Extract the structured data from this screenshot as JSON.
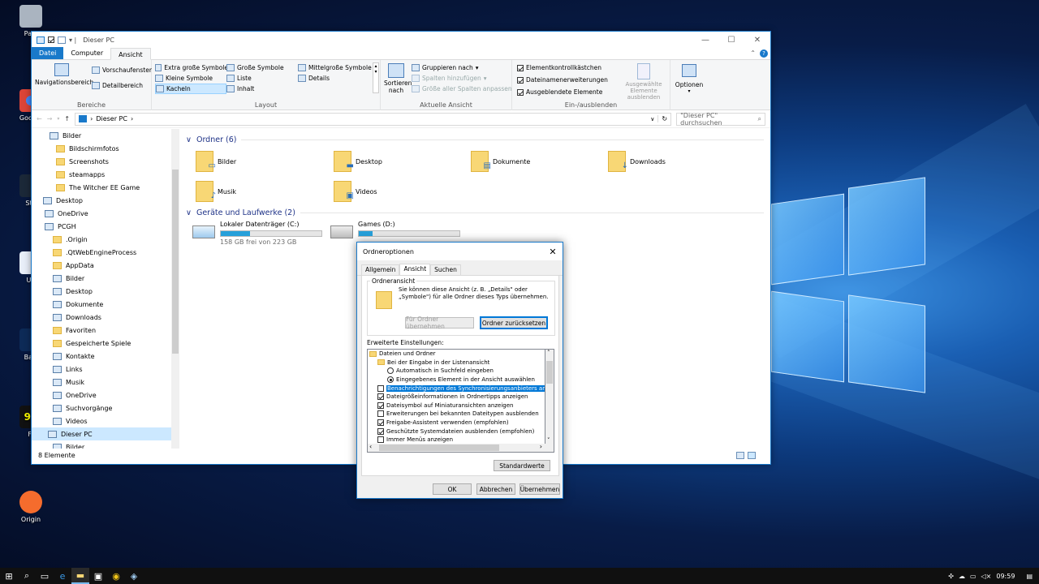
{
  "explorer": {
    "title": "Dieser PC",
    "tabs": [
      "Datei",
      "Computer",
      "Ansicht"
    ],
    "ribbon": {
      "panes": {
        "nav": "Navigationsbereich",
        "preview": "Vorschaufenster",
        "details": "Detailbereich",
        "label": "Bereiche"
      },
      "layout": {
        "items": [
          "Extra große Symbole",
          "Große Symbole",
          "Mittelgroße Symbole",
          "Kleine Symbole",
          "Liste",
          "Details",
          "Kacheln",
          "Inhalt"
        ],
        "label": "Layout"
      },
      "current": {
        "sort": "Sortieren",
        "sort2": "nach",
        "group": "Gruppieren nach",
        "add_cols": "Spalten hinzufügen",
        "fit_cols": "Größe aller Spalten anpassen",
        "label": "Aktuelle Ansicht"
      },
      "showhide": {
        "cb1": "Elementkontrollkästchen",
        "cb2": "Dateinamenerweiterungen",
        "cb3": "Ausgeblendete Elemente",
        "hide1": "Ausgewählte",
        "hide2": "Elemente ausblenden",
        "label": "Ein-/ausblenden"
      },
      "options": "Optionen"
    },
    "address": "Dieser PC",
    "search_placeholder": "\"Dieser PC\" durchsuchen",
    "nav": [
      "Bilder",
      "Bildschirmfotos",
      "Screenshots",
      "steamapps",
      "The Witcher EE Game",
      "Desktop",
      "OneDrive",
      "PCGH",
      ".Origin",
      ".QtWebEngineProcess",
      "AppData",
      "Bilder",
      "Desktop",
      "Dokumente",
      "Downloads",
      "Favoriten",
      "Gespeicherte Spiele",
      "Kontakte",
      "Links",
      "Musik",
      "OneDrive",
      "Suchvorgänge",
      "Videos",
      "Dieser PC",
      "Bilder"
    ],
    "folders_header": "Ordner (6)",
    "folders": [
      "Bilder",
      "Desktop",
      "Dokumente",
      "Downloads",
      "Musik",
      "Videos"
    ],
    "drives_header": "Geräte und Laufwerke (2)",
    "drives": [
      {
        "name": "Lokaler Datenträger (C:)",
        "free": "158 GB frei von 223 GB",
        "used": 0.29
      },
      {
        "name": "Games (D:)",
        "free": "",
        "used": 0.14
      }
    ],
    "status": "8 Elemente"
  },
  "dialog": {
    "title": "Ordneroptionen",
    "tabs": [
      "Allgemein",
      "Ansicht",
      "Suchen"
    ],
    "group": "Ordneransicht",
    "desc1": "Sie können diese Ansicht (z. B. „Details\" oder",
    "desc2": "„Symbole\") für alle Ordner dieses Typs übernehmen.",
    "apply": "Für Ordner übernehmen",
    "reset": "Ordner zurücksetzen",
    "advanced": "Erweiterte Einstellungen:",
    "tree": [
      "Dateien und Ordner",
      "Bei der Eingabe in der Listenansicht",
      "Automatisch in Suchfeld eingeben",
      "Eingegebenes Element in der Ansicht auswählen",
      "Benachrichtigungen des Synchronisierungsanbieters anzeig",
      "Dateigrößeinformationen in Ordnertipps anzeigen",
      "Dateisymbol auf Miniaturansichten anzeigen",
      "Erweiterungen bei bekannten Dateitypen ausblenden",
      "Freigabe-Assistent verwenden (empfohlen)",
      "Geschützte Systemdateien ausblenden (empfohlen)",
      "Immer Menüs anzeigen"
    ],
    "defaults": "Standardwerte",
    "ok": "OK",
    "cancel": "Abbrechen",
    "applybtn": "Übernehmen"
  },
  "desktop": {
    "icons": [
      "Papi",
      "Google",
      "Ste",
      "Up",
      "Batt",
      "Fr",
      "Origin"
    ]
  },
  "taskbar": {
    "time": "09:59"
  }
}
